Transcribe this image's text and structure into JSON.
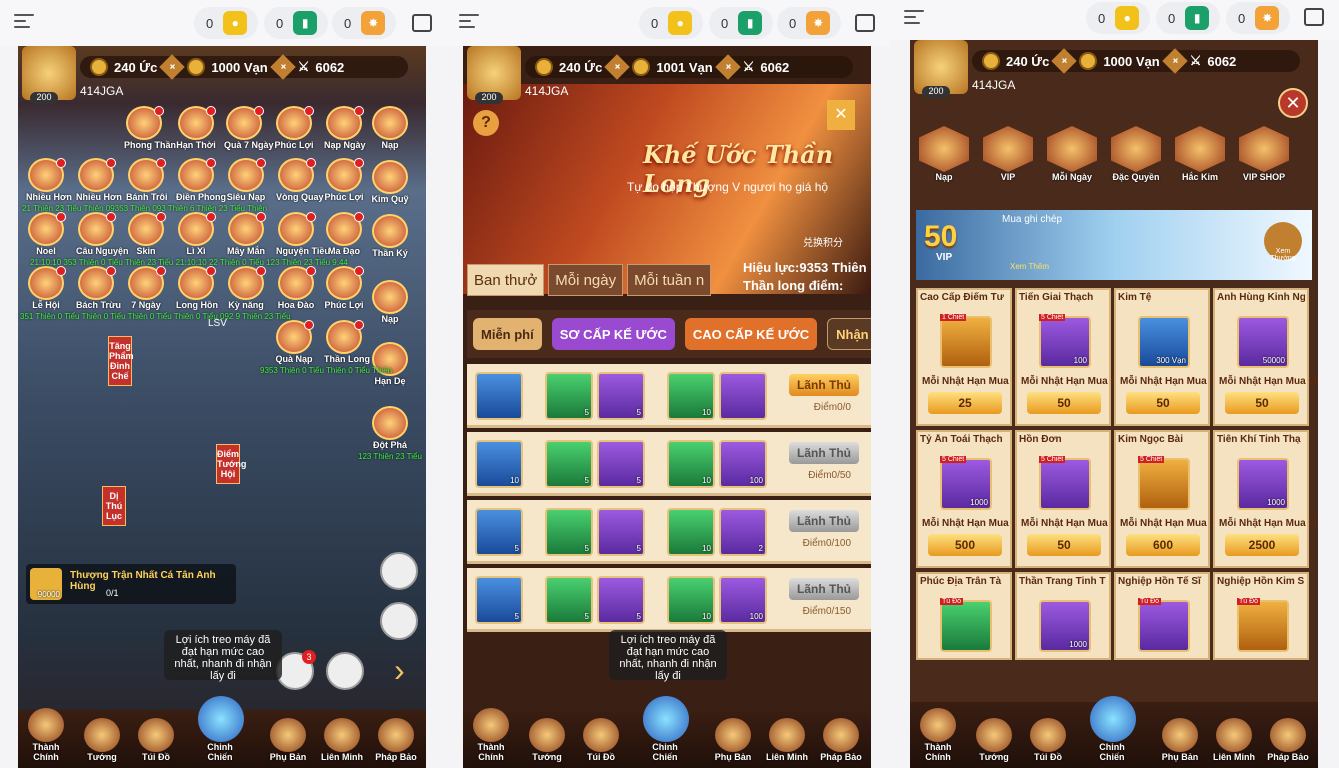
{
  "topbar": {
    "counter1": "0",
    "counter2": "0",
    "counter3": "0"
  },
  "player": {
    "gold": "240 Ức",
    "ingot": "1000 Vạn",
    "ingot_p2": "1001 Vạn",
    "power": "6062",
    "level": "200",
    "id": "414JGA"
  },
  "panel1": {
    "icons": [
      "Phong Thần",
      "Hạn Thời",
      "Quà 7 Ngày",
      "Phúc Lợi",
      "Nạp Ngày",
      "Nhiều Hơn",
      "Nhiều Hơn",
      "Bánh Trôi",
      "Điền Phong",
      "Siêu Nạp",
      "Vòng Quay",
      "Phúc Lợi",
      "Noel",
      "Câu Nguyện",
      "Skin",
      "Lì Xì",
      "Mây Mắn",
      "Nguyện Tiều",
      "Ma Đạo",
      "Lễ Hội",
      "Bách Trừu",
      "7 Ngày",
      "Long Hồn",
      "Kỳ năng",
      "Hoa Đào",
      "Phúc Lợi",
      "Quà Nạp",
      "Thần Long"
    ],
    "side": [
      "Nạp",
      "Kim Quỹ",
      "Thần Ký",
      "Nạp",
      "Hạn Dẹ",
      "Đột Phá"
    ],
    "timers": [
      "21 Thiên 23 Tiểu Thiên 09353 Thiên 093 Thiên 6 Thiên 23 Tiểu Thiên",
      "21:10:10 353 Thiên 0 Tiểu Thiên 23 Tiểu 21:10:10 22 Thiên 0 Tiểu 123 Thiên 23 Tiểu 9:44",
      "351 Thiên 0 Tiểu Thiên 0 Tiểu Thiên 0 Tiểu Thiên 0 Tiểu 092 9 Thiên 23 Tiểu",
      "9353 Thiên 0 Tiểu Thiên 0 Tiểu Thiên",
      "123 Thiên 23 Tiểu"
    ],
    "banners": [
      "Tăng Phẩm Đỉnh Chế",
      "Điểm Tướng Hội",
      "Dị Thú Lục"
    ],
    "lsv": "LSV",
    "quest_title": "Thượng Trận Nhất Cá Tân Anh Hùng",
    "quest_count": "0/1",
    "quest_reward": "90000",
    "tip": "Lợi ích treo máy đã đạt hạn mức cao nhất, nhanh đi nhận lấy đi",
    "mail_badge": "3"
  },
  "bottom_nav": [
    "Thành Chính",
    "Tướng",
    "Túi Đồ",
    "Chinh Chiến",
    "Phụ Bản",
    "Liên Minh",
    "Pháp Bảo"
  ],
  "panel2": {
    "title": "Khế Ước Thần Long",
    "desc": "Tự do hộp Thượng V ngươi họ giá hộ",
    "exchange": "兑换积分",
    "validity": "Hiệu lực:9353 Thiên",
    "points": "Thần long điểm:",
    "tabs": [
      "Ban thưở",
      "Mỗi ngày",
      "Mỗi tuần n"
    ],
    "cats": [
      "Miễn phí",
      "SƠ CẤP KẾ ƯỚC",
      "CAO CẤP KẾ ƯỚC",
      "Nhận nhan"
    ],
    "claim": "Lãnh Thủ",
    "rows": [
      {
        "q1": "",
        "q2": "5",
        "q3": "5",
        "q4": "10",
        "q5": "",
        "pts": "Điểm0/0",
        "gold": true
      },
      {
        "q1": "10",
        "q2": "5",
        "q3": "5",
        "q4": "10",
        "q5": "100",
        "pts": "Điểm0/50",
        "gold": false
      },
      {
        "q1": "5",
        "q2": "5",
        "q3": "5",
        "q4": "10",
        "q5": "2",
        "pts": "Điểm0/100",
        "gold": false
      },
      {
        "q1": "5",
        "q2": "5",
        "q3": "5",
        "q4": "10",
        "q5": "100",
        "pts": "Điểm0/150",
        "gold": false
      }
    ],
    "tip": "Lợi ích treo máy đã đạt hạn mức cao nhất, nhanh đi nhận lấy đi",
    "new_tag": "Tủ Đồ"
  },
  "panel3": {
    "tabs": [
      "Nạp",
      "VIP",
      "Mỗi Ngày",
      "Đặc Quyền",
      "Hắc Kim",
      "VIP SHOP"
    ],
    "vip_level": "50",
    "vip_text": "VIP",
    "vip_note": "Mua ghi chép",
    "vip_link": "Xem Thêm",
    "vip_link2": "Xem Thưởng",
    "limit": "Mỗi Nhật Hạn Mua 0/",
    "cards": [
      {
        "name": "Cao Cấp Điểm Tư",
        "price": "25",
        "tag": "1 Chiết",
        "qty": "",
        "color": "igold"
      },
      {
        "name": "Tiến Giai Thạch",
        "price": "50",
        "tag": "5 Chiết",
        "qty": "100",
        "color": "ipur"
      },
      {
        "name": "Kim Tệ",
        "price": "50",
        "tag": "",
        "qty": "300 Vạn",
        "color": "iblue"
      },
      {
        "name": "Anh Hùng Kinh Ng",
        "price": "50",
        "tag": "",
        "qty": "50000",
        "color": "ipur"
      },
      {
        "name": "Tỷ Ấn Toái Thạch",
        "price": "500",
        "tag": "5 Chiết",
        "qty": "1000",
        "color": "ipur"
      },
      {
        "name": "Hồn Đơn",
        "price": "50",
        "tag": "5 Chiết",
        "qty": "",
        "color": "ipur"
      },
      {
        "name": "Kim Ngọc Bài",
        "price": "600",
        "tag": "5 Chiết",
        "qty": "",
        "color": "igold"
      },
      {
        "name": "Tiên Khí Tinh Thạ",
        "price": "2500",
        "tag": "",
        "qty": "1000",
        "color": "ipur"
      },
      {
        "name": "Phúc Địa Trân Tà",
        "price": "",
        "tag": "Tủ Đồ",
        "qty": "",
        "color": "igreen"
      },
      {
        "name": "Thần Trang Tinh T",
        "price": "",
        "tag": "",
        "qty": "1000",
        "color": "ipur"
      },
      {
        "name": "Nghiệp Hồn Tế Sĩ",
        "price": "",
        "tag": "Tủ Đồ",
        "qty": "",
        "color": "ipur"
      },
      {
        "name": "Nghiệp Hồn Kim S",
        "price": "",
        "tag": "Tủ Đồ",
        "qty": "",
        "color": "igold"
      }
    ]
  }
}
